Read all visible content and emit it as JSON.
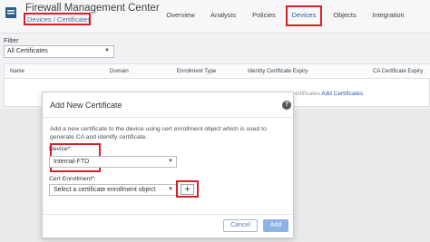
{
  "app": {
    "title": "Firewall Management Center",
    "breadcrumb": "Devices / Certificates",
    "logo_icon": "firewall-logo-icon"
  },
  "nav": {
    "items": [
      {
        "label": "Overview"
      },
      {
        "label": "Analysis"
      },
      {
        "label": "Policies"
      },
      {
        "label": "Devices",
        "active": true
      },
      {
        "label": "Objects"
      },
      {
        "label": "Integration"
      }
    ]
  },
  "filter": {
    "label": "Filter",
    "selected": "All Certificates"
  },
  "table": {
    "columns": [
      "Name",
      "Domain",
      "Enrollment Type",
      "Identity Certificate Expiry",
      "CA Certificate Expiry"
    ],
    "empty_text": "ertificates",
    "empty_link": "Add Certificates"
  },
  "modal": {
    "title": "Add New Certificate",
    "help_icon": "?",
    "description": "Add a new certificate to the device using cert enrollment object which is used to generate CA and identify certificate.",
    "device_label": "Device*:",
    "device_value": "Internal-FTD",
    "cert_label": "Cert Enrollment*:",
    "cert_placeholder": "Select a certificate enrollment object",
    "add_enrollment_symbol": "+",
    "cancel_label": "Cancel",
    "add_label": "Add"
  },
  "colors": {
    "highlight": "#d81f26",
    "link": "#1f5fa8",
    "primary_button": "#8bb3e6"
  }
}
